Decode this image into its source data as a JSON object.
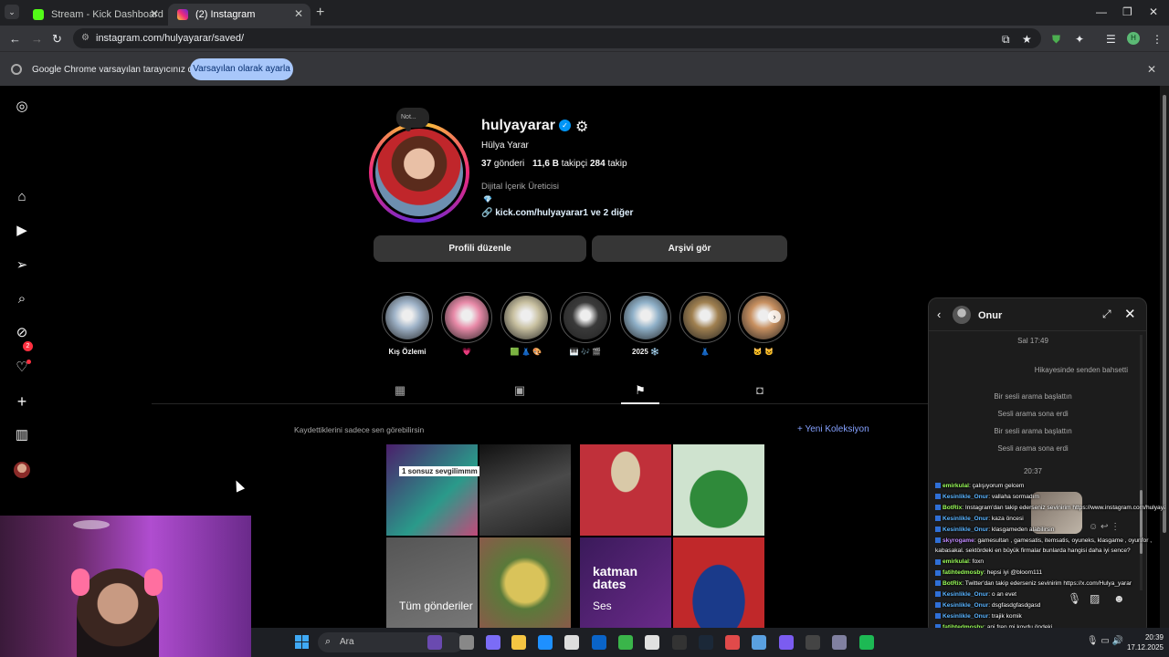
{
  "browser": {
    "tabs": [
      {
        "title": "Stream - Kick Dashboard",
        "favicon_color": "#53fc18"
      },
      {
        "title": "(2) Instagram",
        "favicon_color": "#e1306c"
      }
    ],
    "url": "instagram.com/hulyayarar/saved/",
    "profile_initial": "H",
    "infobar": {
      "message": "Google Chrome varsayılan tarayıcınız değil",
      "button": "Varsayılan olarak ayarla"
    }
  },
  "sidebar": {
    "notification_count": "2"
  },
  "profile": {
    "note": "Not...",
    "username": "hulyayarar",
    "full_name": "Hülya Yarar",
    "posts_count": "37",
    "posts_label": "gönderi",
    "followers_count": "11,6 B",
    "followers_label": "takipçi",
    "following_count": "284",
    "following_label": "takip",
    "category": "Dijital İçerik Üreticisi",
    "link": "kick.com/hulyayarar1 ve 2 diğer",
    "edit_button": "Profili düzenle",
    "archive_button": "Arşivi gör"
  },
  "highlights": [
    {
      "label": "Kış Özlemi",
      "color": "#9fb3c8"
    },
    {
      "label": "💗",
      "color": "#e88aa8"
    },
    {
      "label": "🟩 👗 🎨",
      "color": "#c8c0a0"
    },
    {
      "label": "🎹 🎶 🎬",
      "color": "#3a3a3a"
    },
    {
      "label": "2025 ❄️",
      "color": "#8fb0c8"
    },
    {
      "label": "👗",
      "color": "#a08050"
    },
    {
      "label": "🐱 😺",
      "color": "#c89060"
    }
  ],
  "saved": {
    "private_note": "Kaydettiklerini sadece sen görebilirsin",
    "new_collection": "+ Yeni Koleksiyon",
    "collections": [
      {
        "title": "Tüm gönderiler",
        "sticker": "1 sonsuz sevgilimmm"
      },
      {
        "title": "Ses",
        "sticker": "katman dates"
      }
    ]
  },
  "dm": {
    "name": "Onur",
    "time1": "Sal 17:49",
    "mention": "Hikayesinde senden bahsetti",
    "events": [
      "Bir sesli arama başlattın",
      "Sesli arama sona erdi",
      "Bir sesli arama başlattın",
      "Sesli arama sona erdi"
    ],
    "time2": "20:37"
  },
  "stream_chat": [
    {
      "user": "emirkulal",
      "color": "#9bff5a",
      "text": ": çalışıyorum gelcem"
    },
    {
      "user": "Kesinlikle_Onur",
      "color": "#5ab4ff",
      "text": ": vallaha sormadım"
    },
    {
      "user": "BotRix",
      "color": "#9bff5a",
      "text": ": Instagram'dan takip ederseniz sevinirim https://www.instagram.com/hulyayarar"
    },
    {
      "user": "Kesinlikle_Onur",
      "color": "#5ab4ff",
      "text": ": kaza öncesi"
    },
    {
      "user": "Kesinlikle_Onur",
      "color": "#5ab4ff",
      "text": ": klasgameden alabilirsin"
    },
    {
      "user": "skyrogame",
      "color": "#c08aff",
      "text": ": gamesultan , gamesatis, itemsatis, oyuneks, klasgame , oyunfor , kabasakal. sektördeki en büyük firmalar bunlarda hangisi daha iyi sence?"
    },
    {
      "user": "emirkulal",
      "color": "#9bff5a",
      "text": ": foxn"
    },
    {
      "user": "fatihtedmosby",
      "color": "#9bff5a",
      "text": ": hepsi iyi @bloom111"
    },
    {
      "user": "BotRix",
      "color": "#9bff5a",
      "text": ": Twitter'dan takip ederseniz sevinirim https://x.com/Hulya_yarar"
    },
    {
      "user": "Kesinlikle_Onur",
      "color": "#5ab4ff",
      "text": ": o an evet"
    },
    {
      "user": "Kesinlikle_Onur",
      "color": "#5ab4ff",
      "text": ": dsgfasdgfasdgasd"
    },
    {
      "user": "Kesinlikle_Onur",
      "color": "#5ab4ff",
      "text": ": trajik komik"
    },
    {
      "user": "fatihtedmosby",
      "color": "#9bff5a",
      "text": ": ani fren mi koydu öndeki"
    }
  ],
  "taskbar": {
    "search_placeholder": "Ara",
    "time": "20:39",
    "date": "17.12.2025"
  }
}
